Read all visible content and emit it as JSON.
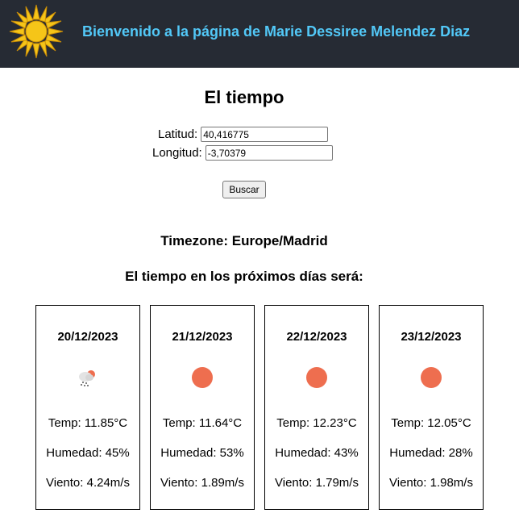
{
  "header": {
    "title": "Bienvenido a la página de Marie Dessiree Melendez Diaz",
    "logo_icon": "sun-icon"
  },
  "page_title": "El tiempo",
  "form": {
    "lat_label": "Latitud:",
    "lat_value": "40,416775",
    "lon_label": "Longitud:",
    "lon_value": "-3,70379",
    "button_label": "Buscar"
  },
  "timezone": {
    "label": "Timezone:",
    "value": "Europe/Madrid"
  },
  "forecast_title": "El tiempo en los próximos días será:",
  "days": [
    {
      "date": "20/12/2023",
      "icon": "light-rain-icon",
      "temp": "Temp: 11.85°C",
      "humidity": "Humedad: 45%",
      "wind": "Viento: 4.24m/s"
    },
    {
      "date": "21/12/2023",
      "icon": "clear-sky-icon",
      "temp": "Temp: 11.64°C",
      "humidity": "Humedad: 53%",
      "wind": "Viento: 1.89m/s"
    },
    {
      "date": "22/12/2023",
      "icon": "clear-sky-icon",
      "temp": "Temp: 12.23°C",
      "humidity": "Humedad: 43%",
      "wind": "Viento: 1.79m/s"
    },
    {
      "date": "23/12/2023",
      "icon": "clear-sky-icon",
      "temp": "Temp: 12.05°C",
      "humidity": "Humedad: 28%",
      "wind": "Viento: 1.98m/s"
    }
  ],
  "colors": {
    "header_bg": "#262b34",
    "header_text": "#52c8f7",
    "sun_logo": "#f5c518",
    "clear_sky": "#ee6e4f"
  }
}
